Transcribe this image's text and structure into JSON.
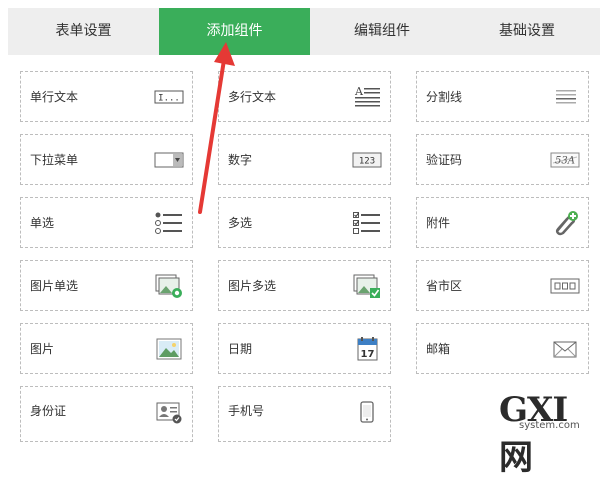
{
  "tabs": [
    {
      "label": "表单设置"
    },
    {
      "label": "添加组件",
      "active": true
    },
    {
      "label": "编辑组件"
    },
    {
      "label": "基础设置"
    }
  ],
  "components": [
    {
      "label": "单行文本",
      "icon": "single-line-text-icon"
    },
    {
      "label": "多行文本",
      "icon": "multi-line-text-icon"
    },
    {
      "label": "分割线",
      "icon": "divider-icon"
    },
    {
      "label": "下拉菜单",
      "icon": "dropdown-icon"
    },
    {
      "label": "数字",
      "icon": "number-icon"
    },
    {
      "label": "验证码",
      "icon": "captcha-icon"
    },
    {
      "label": "单选",
      "icon": "radio-list-icon"
    },
    {
      "label": "多选",
      "icon": "checkbox-list-icon"
    },
    {
      "label": "附件",
      "icon": "attachment-icon"
    },
    {
      "label": "图片单选",
      "icon": "image-radio-icon"
    },
    {
      "label": "图片多选",
      "icon": "image-checkbox-icon"
    },
    {
      "label": "省市区",
      "icon": "region-icon"
    },
    {
      "label": "图片",
      "icon": "image-icon"
    },
    {
      "label": "日期",
      "icon": "calendar-icon"
    },
    {
      "label": "邮箱",
      "icon": "mail-icon"
    },
    {
      "label": "身份证",
      "icon": "id-card-icon"
    },
    {
      "label": "手机号",
      "icon": "phone-icon"
    }
  ],
  "icon_text": {
    "single_line": "I...",
    "number": "123",
    "captcha": "53A",
    "calendar_day": "17"
  },
  "watermark": {
    "brand": "GXI网",
    "domain": "system.com"
  },
  "colors": {
    "accent": "#3aae5a",
    "arrow": "#e53935"
  }
}
